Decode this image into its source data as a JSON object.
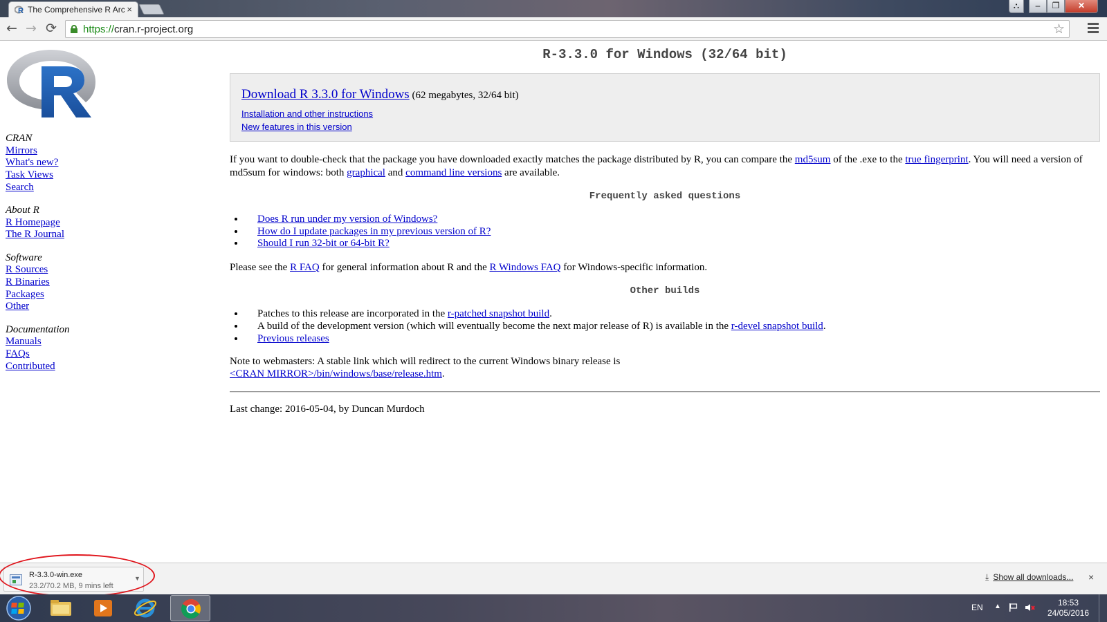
{
  "browser": {
    "tab_title": "The Comprehensive R Arc",
    "tab_close": "×",
    "url_scheme": "https://",
    "url_host": "cran.r-project.org",
    "window_controls": {
      "user": "⛬",
      "minimize": "–",
      "maximize": "❐",
      "close": "✕"
    },
    "nav": {
      "back": "←",
      "forward": "→",
      "reload": "⟳",
      "bookmark": "☆"
    }
  },
  "sidebar": {
    "sections": [
      {
        "heading": "CRAN",
        "links": [
          "Mirrors",
          "What's new?",
          "Task Views",
          "Search"
        ]
      },
      {
        "heading": "About R",
        "links": [
          "R Homepage",
          "The R Journal"
        ]
      },
      {
        "heading": "Software",
        "links": [
          "R Sources",
          "R Binaries",
          "Packages",
          "Other"
        ]
      },
      {
        "heading": "Documentation",
        "links": [
          "Manuals",
          "FAQs",
          "Contributed"
        ]
      }
    ]
  },
  "main": {
    "title": "R-3.3.0 for Windows (32/64 bit)",
    "download": {
      "link": "Download R 3.3.0 for Windows",
      "size_note": "(62 megabytes, 32/64 bit)",
      "install_link": "Installation and other instructions",
      "features_link": "New features in this version"
    },
    "check": {
      "text1": "If you want to double-check that the package you have downloaded exactly matches the package distributed by R, you can compare the ",
      "md5_link": "md5sum",
      "text2": " of the .exe to the ",
      "fingerprint_link": "true fingerprint",
      "text3": ". You will need a version of md5sum for windows: both ",
      "graphical_link": "graphical",
      "text4": " and ",
      "cmdline_link": "command line versions",
      "text5": " are available."
    },
    "faq_heading": "Frequently asked questions",
    "faq_items": [
      "Does R run under my version of Windows?",
      "How do I update packages in my previous version of R?",
      "Should I run 32-bit or 64-bit R?"
    ],
    "faq_para": {
      "text1": "Please see the ",
      "rfaq_link": "R FAQ",
      "text2": " for general information about R and the ",
      "winfaq_link": "R Windows FAQ",
      "text3": " for Windows-specific information."
    },
    "builds_heading": "Other builds",
    "builds": {
      "item1_text": "Patches to this release are incorporated in the ",
      "item1_link": "r-patched snapshot build",
      "item1_end": ".",
      "item2_text": "A build of the development version (which will eventually become the next major release of R) is available in the ",
      "item2_link": "r-devel snapshot build",
      "item2_end": ".",
      "item3_link": "Previous releases"
    },
    "note": {
      "text": "Note to webmasters: A stable link which will redirect to the current Windows binary release is",
      "link": "<CRAN MIRROR>/bin/windows/base/release.htm",
      "end": "."
    },
    "last_change": "Last change: 2016-05-04, by Duncan Murdoch"
  },
  "download_shelf": {
    "filename": "R-3.3.0-win.exe",
    "status": "23.2/70.2 MB, 9 mins left",
    "show_all_icon": "⤓",
    "show_all": "Show all downloads...",
    "close": "×"
  },
  "taskbar": {
    "language": "EN",
    "time": "18:53",
    "date": "24/05/2016"
  }
}
